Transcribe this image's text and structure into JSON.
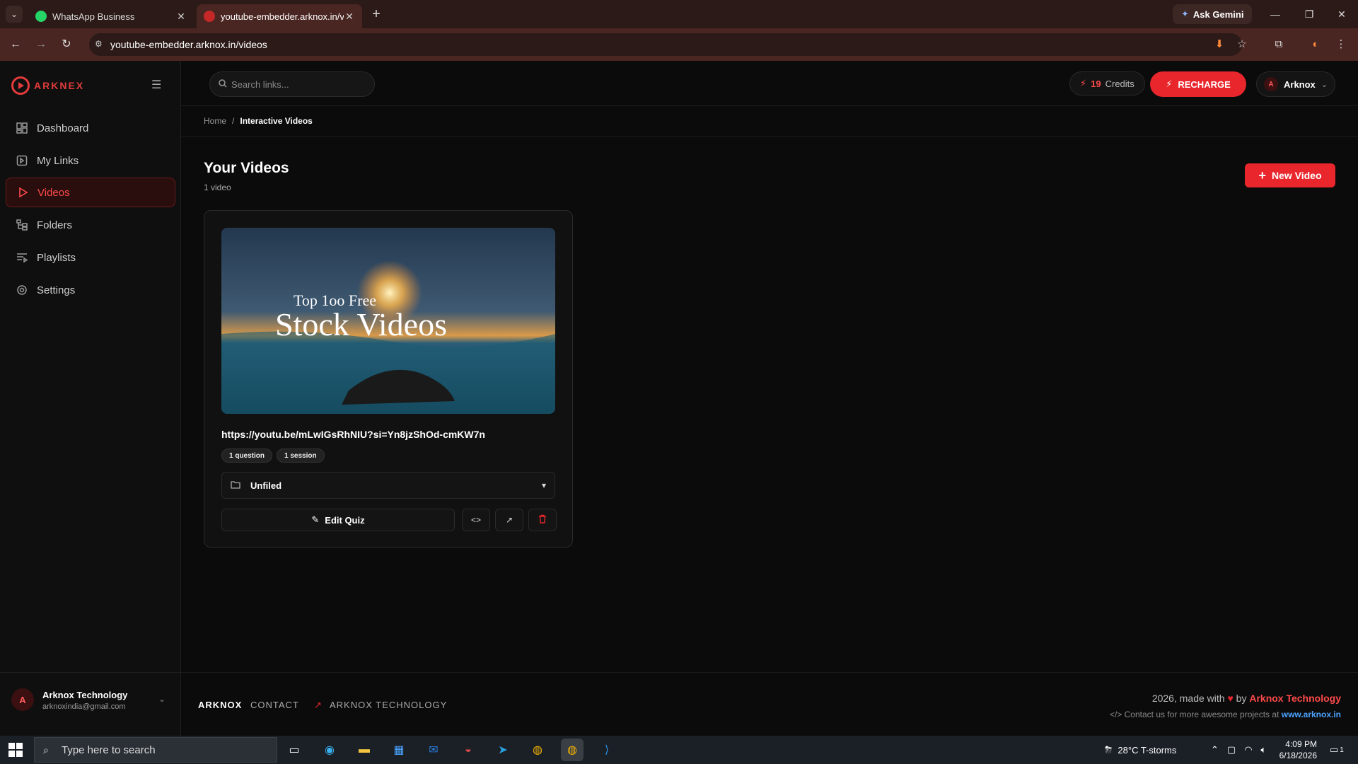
{
  "browser": {
    "tabs": [
      {
        "title": "WhatsApp Business",
        "active": false
      },
      {
        "title": "youtube-embedder.arknox.in/v",
        "active": true
      }
    ],
    "url": "youtube-embedder.arknox.in/videos",
    "gemini_label": "Ask Gemini"
  },
  "sidebar": {
    "brand": "ARKNEX",
    "items": [
      {
        "label": "Dashboard",
        "icon": "dashboard-icon",
        "active": false
      },
      {
        "label": "My Links",
        "icon": "link-icon",
        "active": false
      },
      {
        "label": "Videos",
        "icon": "play-icon",
        "active": true
      },
      {
        "label": "Folders",
        "icon": "folder-tree-icon",
        "active": false
      },
      {
        "label": "Playlists",
        "icon": "playlist-icon",
        "active": false
      },
      {
        "label": "Settings",
        "icon": "gear-icon",
        "active": false
      }
    ],
    "user": {
      "initial": "A",
      "name": "Arknox Technology",
      "email": "arknoxindia@gmail.com"
    }
  },
  "topbar": {
    "search_placeholder": "Search links...",
    "credits_count": "19",
    "credits_label": "Credits",
    "recharge_label": "RECHARGE",
    "account_initial": "A",
    "account_name": "Arknox"
  },
  "breadcrumb": {
    "home": "Home",
    "separator": "/",
    "current": "Interactive Videos"
  },
  "page": {
    "title": "Your Videos",
    "count": "1 video",
    "new_button": "New Video"
  },
  "video_card": {
    "thumbnail_text_top": "Top 1oo Free",
    "thumbnail_text_main": "Stock Videos",
    "url": "https://youtu.be/mLwIGsRhNIU?si=Yn8jzShOd-cmKW7n",
    "chips": [
      "1 question",
      "1 session"
    ],
    "folder": "Unfiled",
    "edit_label": "Edit Quiz"
  },
  "footer": {
    "links": [
      "ARKNOX",
      "CONTACT",
      "ARKNOX TECHNOLOGY"
    ],
    "made_prefix": "2026, made with",
    "made_by": "by",
    "made_brand": "Arknox Technology",
    "contact_text": "Contact us for more awesome projects at",
    "contact_site": "www.arknox.in"
  },
  "taskbar": {
    "search_placeholder": "Type here to search",
    "weather": "28°C  T-storms",
    "time": "4:09 PM",
    "date": "6/18/2026",
    "notification_count": "1"
  },
  "colors": {
    "accent": "#e8262c",
    "brand_red": "#ff4a4a",
    "link_blue": "#4da3ff"
  }
}
